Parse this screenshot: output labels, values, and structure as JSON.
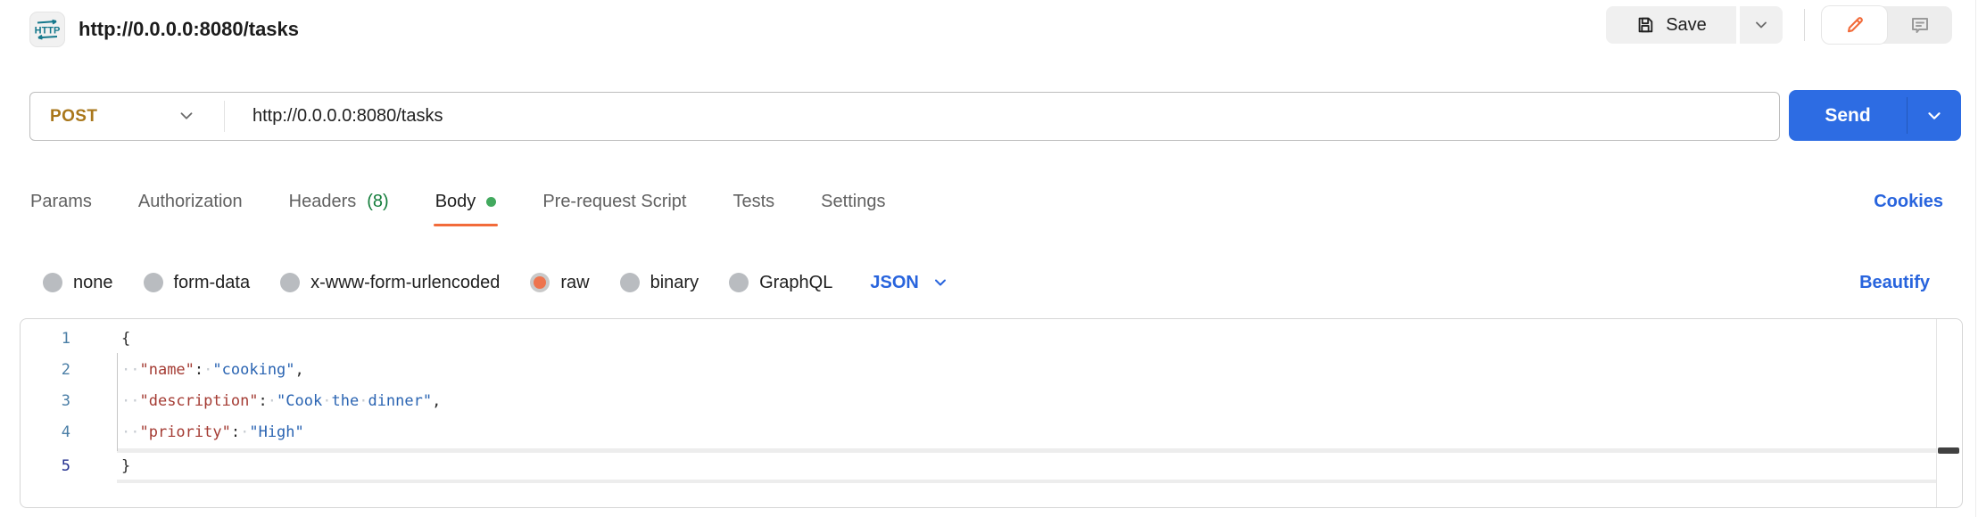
{
  "header": {
    "title": "http://0.0.0.0:8080/tasks",
    "save_label": "Save",
    "http_badge_text": "HTTP"
  },
  "request": {
    "method": "POST",
    "url": "http://0.0.0.0:8080/tasks",
    "send_label": "Send"
  },
  "tabs": {
    "items": [
      {
        "label": "Params"
      },
      {
        "label": "Authorization"
      },
      {
        "label": "Headers",
        "count": "(8)"
      },
      {
        "label": "Body",
        "active": true,
        "dot": true
      },
      {
        "label": "Pre-request Script"
      },
      {
        "label": "Tests"
      },
      {
        "label": "Settings"
      }
    ],
    "cookies_link": "Cookies"
  },
  "body_type": {
    "options": [
      {
        "label": "none"
      },
      {
        "label": "form-data"
      },
      {
        "label": "x-www-form-urlencoded"
      },
      {
        "label": "raw",
        "selected": true
      },
      {
        "label": "binary"
      },
      {
        "label": "GraphQL"
      }
    ],
    "language": "JSON",
    "beautify_link": "Beautify"
  },
  "editor": {
    "language": "JSON",
    "raw_text": "{\n  \"name\": \"cooking\",\n  \"description\": \"Cook the dinner\",\n  \"priority\": \"High\"\n}",
    "active_line": "5",
    "lines": [
      {
        "num": "1",
        "tokens": [
          [
            "p",
            "{"
          ]
        ]
      },
      {
        "num": "2",
        "guide": true,
        "tokens": [
          [
            "w",
            "··"
          ],
          [
            "k",
            "\"name\""
          ],
          [
            "p",
            ":"
          ],
          [
            "w",
            "·"
          ],
          [
            "s",
            "\"cooking\""
          ],
          [
            "p",
            ","
          ]
        ]
      },
      {
        "num": "3",
        "guide": true,
        "tokens": [
          [
            "w",
            "··"
          ],
          [
            "k",
            "\"description\""
          ],
          [
            "p",
            ":"
          ],
          [
            "w",
            "·"
          ],
          [
            "s",
            "\"Cook"
          ],
          [
            "w",
            "·"
          ],
          [
            "s",
            "the"
          ],
          [
            "w",
            "·"
          ],
          [
            "s",
            "dinner\""
          ],
          [
            "p",
            ","
          ]
        ]
      },
      {
        "num": "4",
        "guide": true,
        "tokens": [
          [
            "w",
            "··"
          ],
          [
            "k",
            "\"priority\""
          ],
          [
            "p",
            ":"
          ],
          [
            "w",
            "·"
          ],
          [
            "s",
            "\"High\""
          ]
        ]
      },
      {
        "num": "5",
        "active": true,
        "tokens": [
          [
            "p",
            "}"
          ]
        ]
      }
    ]
  },
  "colors": {
    "accent_orange": "#f26b3a",
    "radio_selected_orange": "#ee744e",
    "link_blue": "#2864dd",
    "send_blue": "#2d6ce3",
    "method_post_amber": "#a9771b",
    "headers_count_green": "#157e3c",
    "body_dot_green": "#42a95e",
    "editor_key_red": "#a43b33",
    "editor_string_blue": "#2a64b2",
    "line_number_blue": "#4a7ea6",
    "active_line_number_navy": "#232f8f"
  }
}
